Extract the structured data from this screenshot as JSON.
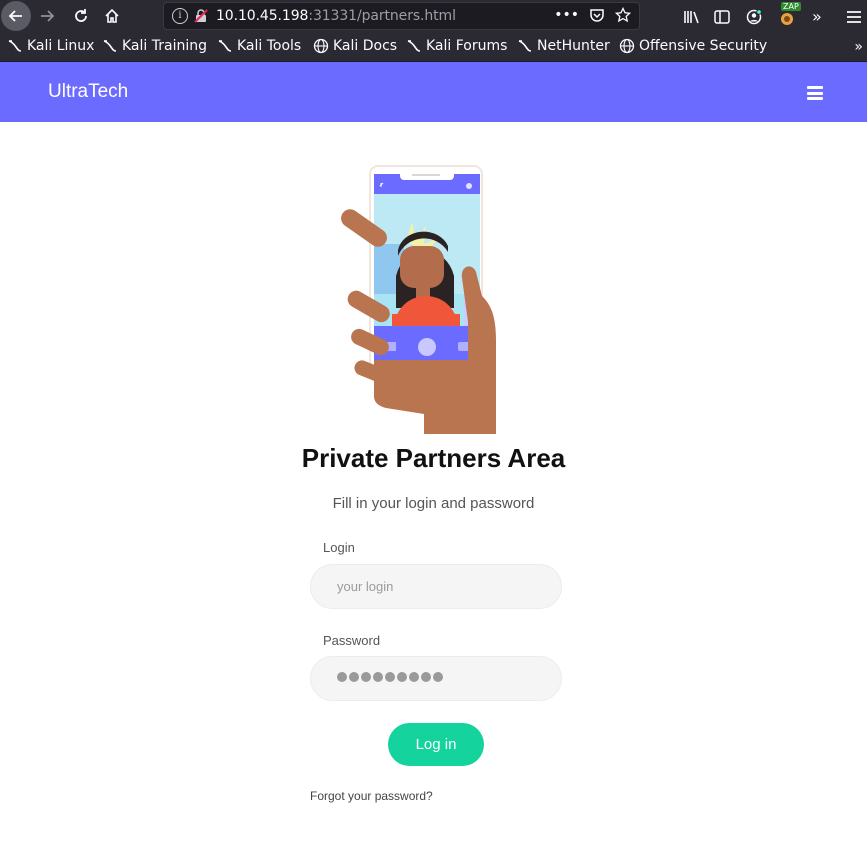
{
  "browser": {
    "url_host": "10.10.45.198",
    "url_rest": ":31331/partners.html",
    "zap_badge": "ZAP",
    "bookmarks": [
      {
        "label": "Kali Linux",
        "icon": "kali-dragon-icon"
      },
      {
        "label": "Kali Training",
        "icon": "kali-dragon-icon"
      },
      {
        "label": "Kali Tools",
        "icon": "kali-dragon-icon"
      },
      {
        "label": "Kali Docs",
        "icon": "globe-icon"
      },
      {
        "label": "Kali Forums",
        "icon": "kali-dragon-icon"
      },
      {
        "label": "NetHunter",
        "icon": "kali-dragon-icon"
      },
      {
        "label": "Offensive Security",
        "icon": "globe-icon"
      }
    ]
  },
  "navbar": {
    "brand": "UltraTech",
    "color": "#6b6bff"
  },
  "main": {
    "title": "Private Partners Area",
    "subtitle": "Fill in your login and password",
    "login_label": "Login",
    "login_placeholder": "your login",
    "password_label": "Password",
    "password_masked": "●●●●●●●●●",
    "submit_label": "Log in",
    "forgot_link": "Forgot your password?",
    "accent_color": "#14d39c"
  }
}
